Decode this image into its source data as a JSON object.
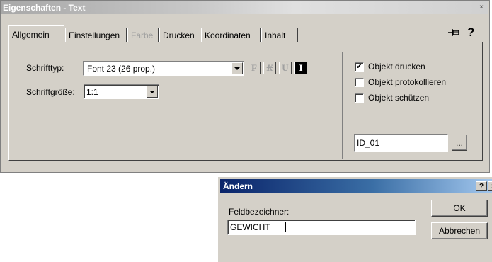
{
  "main_window": {
    "title": "Eigenschaften - Text",
    "close_glyph": "×",
    "pin_glyph": "⊣⊨",
    "help_glyph": "?",
    "tabs": [
      {
        "label": "Allgemein",
        "active": true,
        "enabled": true
      },
      {
        "label": "Einstellungen",
        "active": false,
        "enabled": true
      },
      {
        "label": "Farbe",
        "active": false,
        "enabled": false
      },
      {
        "label": "Drucken",
        "active": false,
        "enabled": true
      },
      {
        "label": "Koordinaten",
        "active": false,
        "enabled": true
      },
      {
        "label": "Inhalt",
        "active": false,
        "enabled": true
      }
    ],
    "font_label": "Schrifttyp:",
    "font_value": "Font 23 (26 prop.)",
    "size_label": "Schriftgröße:",
    "size_value": "1:1",
    "format_buttons": {
      "bold": "F",
      "italic": "K",
      "underline": "U",
      "inverse": "I"
    },
    "checkboxes": [
      {
        "label": "Objekt drucken",
        "checked": true
      },
      {
        "label": "Objekt protokollieren",
        "checked": false
      },
      {
        "label": "Objekt schützen",
        "checked": false
      }
    ],
    "id_value": "ID_01",
    "browse_label": "..."
  },
  "dialog": {
    "title": "Ändern",
    "help_glyph": "?",
    "close_glyph": "×",
    "field_label": "Feldbezeichner:",
    "field_value": "GEWICHT",
    "ok_label": "OK",
    "cancel_label": "Abbrechen"
  }
}
